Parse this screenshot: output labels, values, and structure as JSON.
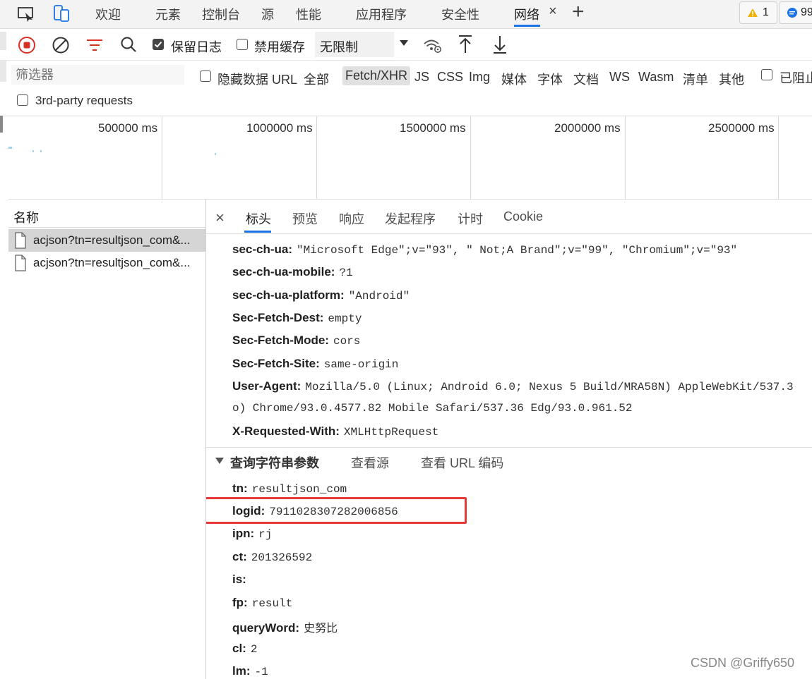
{
  "tabbar": {
    "tabs": [
      "欢迎",
      "元素",
      "控制台",
      "源",
      "性能",
      "应用程序",
      "安全性",
      "网络"
    ],
    "active_tab": "网络",
    "close_glyph": "×",
    "add_glyph": "+",
    "warnings_count": "1",
    "messages_count": "99"
  },
  "toolbar": {
    "preserve_log_label": "保留日志",
    "preserve_log_checked": true,
    "disable_cache_label": "禁用缓存",
    "disable_cache_checked": false,
    "throttling_value": "无限制"
  },
  "filter": {
    "placeholder": "筛选器",
    "hide_data_url_label": "隐藏数据 URL",
    "types": [
      "全部",
      "Fetch/XHR",
      "JS",
      "CSS",
      "Img",
      "媒体",
      "字体",
      "文档",
      "WS",
      "Wasm",
      "清单",
      "其他"
    ],
    "active_type": "Fetch/XHR",
    "blocked_label": "已阻止",
    "third_party_label": "3rd-party requests"
  },
  "overview": {
    "ticks": [
      "500000 ms",
      "1000000 ms",
      "1500000 ms",
      "2000000 ms",
      "2500000 ms"
    ]
  },
  "request_list": {
    "header": "名称",
    "rows": [
      {
        "name": "acjson?tn=resultjson_com&...",
        "selected": true
      },
      {
        "name": "acjson?tn=resultjson_com&...",
        "selected": false
      }
    ]
  },
  "details": {
    "close_glyph": "×",
    "tabs": [
      "标头",
      "预览",
      "响应",
      "发起程序",
      "计时",
      "Cookie"
    ],
    "active_tab": "标头",
    "headers": [
      {
        "key": "sec-ch-ua:",
        "value": "\"Microsoft Edge\";v=\"93\", \" Not;A Brand\";v=\"99\", \"Chromium\";v=\"93\""
      },
      {
        "key": "sec-ch-ua-mobile:",
        "value": "?1"
      },
      {
        "key": "sec-ch-ua-platform:",
        "value": "\"Android\""
      },
      {
        "key": "Sec-Fetch-Dest:",
        "value": "empty"
      },
      {
        "key": "Sec-Fetch-Mode:",
        "value": "cors"
      },
      {
        "key": "Sec-Fetch-Site:",
        "value": "same-origin"
      },
      {
        "key": "User-Agent:",
        "value": "Mozilla/5.0 (Linux; Android 6.0; Nexus 5 Build/MRA58N) AppleWebKit/537.3"
      },
      {
        "key": "",
        "value": "o) Chrome/93.0.4577.82 Mobile Safari/537.36 Edg/93.0.961.52"
      },
      {
        "key": "X-Requested-With:",
        "value": "XMLHttpRequest"
      }
    ],
    "query_section": {
      "title": "查询字符串参数",
      "view_source": "查看源",
      "view_url_encoded": "查看 URL 编码"
    },
    "query_params": [
      {
        "key": "tn:",
        "value": "resultjson_com"
      },
      {
        "key": "logid:",
        "value": "7911028307282006856"
      },
      {
        "key": "ipn:",
        "value": "rj"
      },
      {
        "key": "ct:",
        "value": "201326592"
      },
      {
        "key": "is:",
        "value": ""
      },
      {
        "key": "fp:",
        "value": "result"
      },
      {
        "key": "queryWord:",
        "value": "史努比"
      },
      {
        "key": "cl:",
        "value": "2"
      },
      {
        "key": "lm:",
        "value": "-1"
      }
    ],
    "highlight_color": "#e53935"
  },
  "watermark": "CSDN @Griffy650"
}
